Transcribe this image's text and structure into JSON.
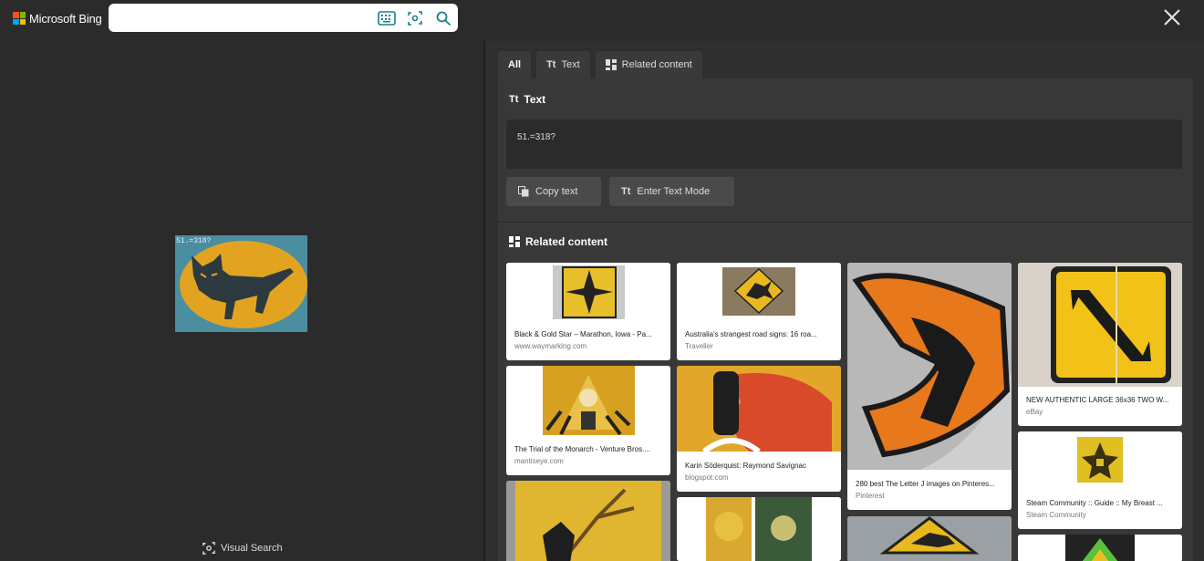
{
  "header": {
    "brand": "Microsoft Bing",
    "search": {
      "value": "",
      "placeholder": ""
    },
    "icons": [
      "keyboard-icon",
      "visual-search-icon",
      "search-icon",
      "close-icon"
    ]
  },
  "left_pane": {
    "image_ocr_overlay": "51.=318?",
    "visual_search_label": "Visual Search"
  },
  "tabs": [
    {
      "label": "All",
      "active": true
    },
    {
      "label": "Text",
      "active": false
    },
    {
      "label": "Related content",
      "active": false
    }
  ],
  "text_section": {
    "title": "Text",
    "extracted_text": "51.=318?",
    "copy_label": "Copy text",
    "enter_mode_label": "Enter Text Mode"
  },
  "related_section": {
    "title": "Related content",
    "items": [
      {
        "title": "Black & Gold Star – Marathon, Iowa - Pa...",
        "source": "www.waymarking.com"
      },
      {
        "title": "Australia's strangest road signs: 16 roa...",
        "source": "Traveller"
      },
      {
        "title": "280 best The Letter J images on Pinteres...",
        "source": "Pinterest"
      },
      {
        "title": "NEW AUTHENTIC LARGE 36x36 TWO W...",
        "source": "eBay"
      },
      {
        "title": "The Trial of the Monarch - Venture Bros....",
        "source": "mantiseye.com"
      },
      {
        "title": "Karin Söderquist: Raymond Savignac",
        "source": "blogspot.com"
      },
      {
        "title": "Steam Community :: Guide :: My Breast ...",
        "source": "Steam Community"
      }
    ]
  },
  "colors": {
    "page_bg": "#2b2b2b",
    "panel_bg": "#383838",
    "accent_teal": "#1b7f8a"
  }
}
